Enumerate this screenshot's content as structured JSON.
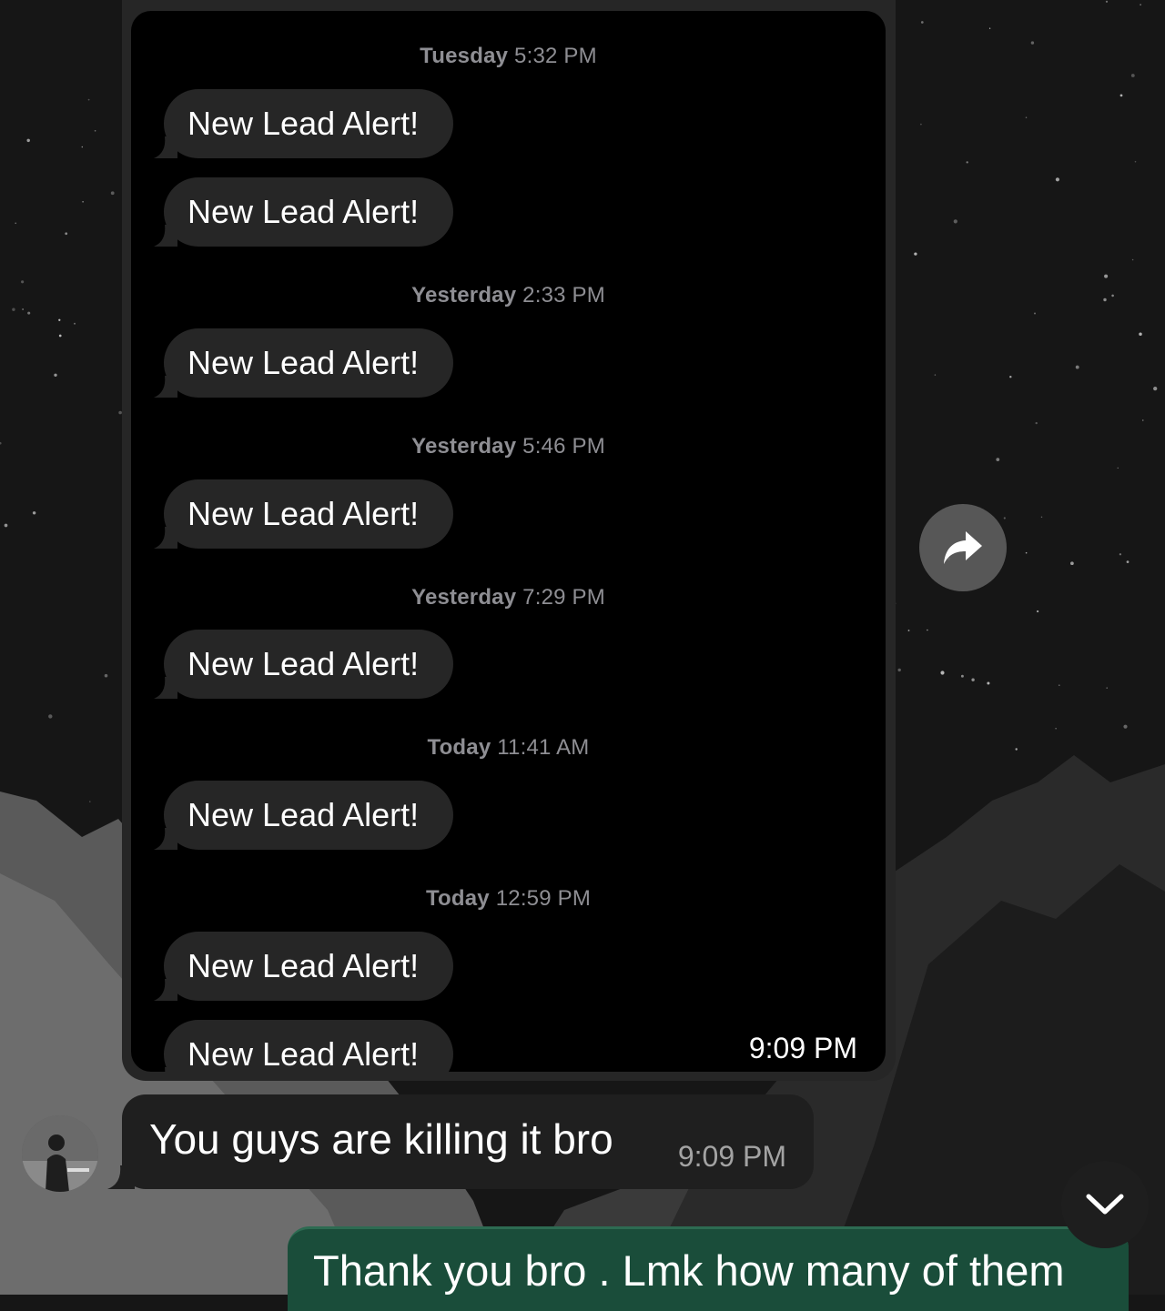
{
  "screenshot": {
    "messages": [
      {
        "timestamp_day": "Tuesday",
        "timestamp_time": "5:32 PM",
        "bubbles": [
          "New Lead Alert!",
          "New Lead Alert!"
        ]
      },
      {
        "timestamp_day": "Yesterday",
        "timestamp_time": "2:33 PM",
        "bubbles": [
          "New Lead Alert!"
        ]
      },
      {
        "timestamp_day": "Yesterday",
        "timestamp_time": "5:46 PM",
        "bubbles": [
          "New Lead Alert!"
        ]
      },
      {
        "timestamp_day": "Yesterday",
        "timestamp_time": "7:29 PM",
        "bubbles": [
          "New Lead Alert!"
        ]
      },
      {
        "timestamp_day": "Today",
        "timestamp_time": "11:41 AM",
        "bubbles": [
          "New Lead Alert!"
        ]
      },
      {
        "timestamp_day": "Today",
        "timestamp_time": "12:59 PM",
        "bubbles": [
          "New Lead Alert!",
          "New Lead Alert!"
        ]
      }
    ],
    "sent_time": "9:09 PM"
  },
  "chat": {
    "incoming": {
      "text": "You guys are killing it bro",
      "time": "9:09 PM"
    },
    "outgoing": {
      "text": "Thank you bro . Lmk how many of them"
    }
  },
  "icons": {
    "forward": "forward-arrow-icon",
    "scroll_down": "chevron-down-icon",
    "avatar": "user-avatar"
  },
  "colors": {
    "outgoing_bubble": "#1a4d3a",
    "incoming_bubble": "#1f1f1f",
    "sms_bubble": "#262626",
    "timestamp": "#8e8e93"
  }
}
